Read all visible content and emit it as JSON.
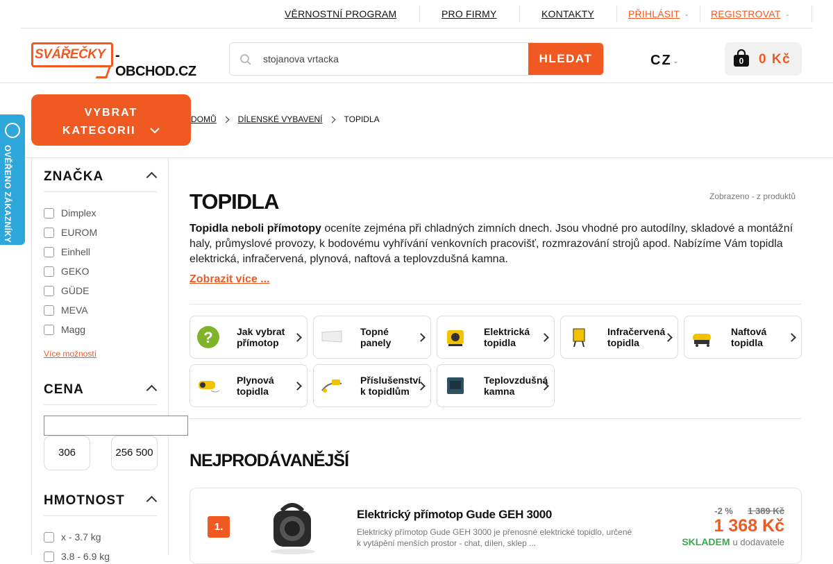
{
  "topbar": {
    "loyalty": "VĚRNOSTNÍ PROGRAM",
    "business": "PRO FIRMY",
    "contacts": "KONTAKTY",
    "login": "PŘIHLÁSIT",
    "register": "REGISTROVAT"
  },
  "logo": {
    "brand": "SVÁŘEČKY",
    "rest": "-OBCHOD.CZ"
  },
  "search": {
    "value": "stojanova vrtacka",
    "button": "HLEDAT"
  },
  "lang": "CZ",
  "cart": {
    "count": "0",
    "price": "0 Kč"
  },
  "category_button": {
    "line1": "VYBRAT",
    "line2": "KATEGORII"
  },
  "breadcrumb": [
    "DOMŮ",
    "DÍLENSKÉ VYBAVENÍ",
    "TOPIDLA"
  ],
  "badge": "OVĚŘENO ZÁKAZNÍKY",
  "filters": {
    "brand": {
      "title": "ZNAČKA",
      "options": [
        "Dimplex",
        "EUROM",
        "Einhell",
        "GEKO",
        "GÜDE",
        "MEVA",
        "Magg"
      ],
      "more": "Více možností"
    },
    "price": {
      "title": "CENA",
      "min": "306",
      "max": "256 500"
    },
    "weight": {
      "title": "HMOTNOST",
      "options": [
        "x - 3.7 kg",
        "3.8 - 6.9 kg"
      ]
    }
  },
  "main": {
    "title": "TOPIDLA",
    "shown": "Zobrazeno - z produktů",
    "desc_bold": "Topidla neboli přímotopy",
    "desc_rest": " oceníte zejména při chladných zimních dnech. Jsou vhodné pro autodílny, skladové a montážní haly, průmyslové provozy, k bodovému vyhřívání venkovních pracovišť, rozmrazování strojů apod. Nabízíme Vám topidla elektrická, infračervená, plynová, naftová a teplovzdušná kamna.",
    "show_more": "Zobrazit více ...",
    "categories": [
      {
        "line1": "Jak vybrat",
        "line2": "přímotop",
        "icon": "question-icon"
      },
      {
        "line1": "Topné",
        "line2": "panely",
        "icon": "panel-icon"
      },
      {
        "line1": "Elektrická",
        "line2": "topidla",
        "icon": "electric-heater-icon"
      },
      {
        "line1": "Infračervená",
        "line2": "topidla",
        "icon": "infrared-heater-icon"
      },
      {
        "line1": "Naftová",
        "line2": "topidla",
        "icon": "diesel-heater-icon"
      },
      {
        "line1": "Plynová",
        "line2": "topidla",
        "icon": "gas-heater-icon"
      },
      {
        "line1": "Příslušenství",
        "line2": "k topidlům",
        "icon": "accessory-icon"
      },
      {
        "line1": "Teplovzdušná",
        "line2": "kamna",
        "icon": "stove-icon"
      }
    ],
    "bestsellers_title": "NEJPRODÁVANĚJŠÍ",
    "product": {
      "rank": "1.",
      "name": "Elektrický přímotop Gude GEH 3000",
      "desc": "Elektrický přímotop Gude GEH 3000 je přenosné elektrické topidlo, určené k vytápění menších prostor - chat, dílen, sklep ...",
      "discount": "-2 %",
      "old_price": "1 389 Kč",
      "price": "1 368 Kč",
      "stock": "SKLADEM",
      "stock_note": "u dodavatele"
    }
  },
  "colors": {
    "accent": "#f05a22",
    "badge": "#2da6d9",
    "stock": "#3aa84a"
  }
}
